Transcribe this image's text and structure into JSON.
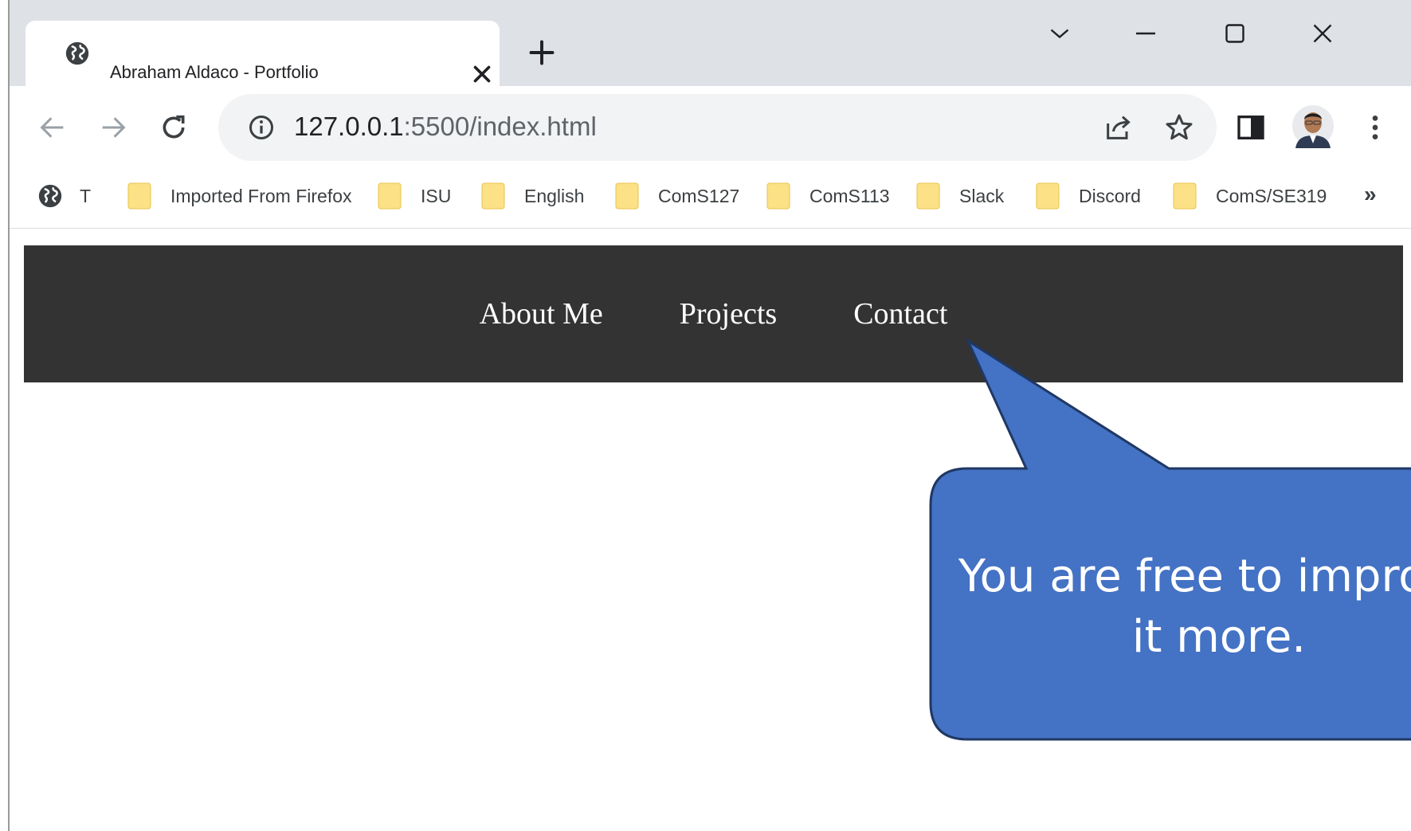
{
  "browser": {
    "tab": {
      "title": "Abraham Aldaco - Portfolio",
      "icon": "globe-icon"
    },
    "new_tab_label": "+",
    "window_controls": [
      "chevron-down-icon",
      "minimize-icon",
      "maximize-icon",
      "close-icon"
    ],
    "address_bar": {
      "host": "127.0.0.1",
      "rest": ":5500/index.html"
    },
    "bookmarks": [
      {
        "label": "T",
        "icon": "globe-icon"
      },
      {
        "label": "Imported From Firefox",
        "icon": "folder-icon"
      },
      {
        "label": "ISU",
        "icon": "folder-icon"
      },
      {
        "label": "English",
        "icon": "folder-icon"
      },
      {
        "label": "ComS127",
        "icon": "folder-icon"
      },
      {
        "label": "ComS113",
        "icon": "folder-icon"
      },
      {
        "label": "Slack",
        "icon": "folder-icon"
      },
      {
        "label": "Discord",
        "icon": "folder-icon"
      },
      {
        "label": "ComS/SE319",
        "icon": "folder-icon"
      }
    ],
    "bookmarks_more": "»"
  },
  "page": {
    "nav": [
      "About Me",
      "Projects",
      "Contact"
    ]
  },
  "callout": {
    "line1": "You are free to improve",
    "line2": "it more."
  },
  "colors": {
    "nav_background": "#333333",
    "callout_fill": "#4472c4",
    "callout_border": "#1f3864",
    "folder": "#fce186"
  }
}
